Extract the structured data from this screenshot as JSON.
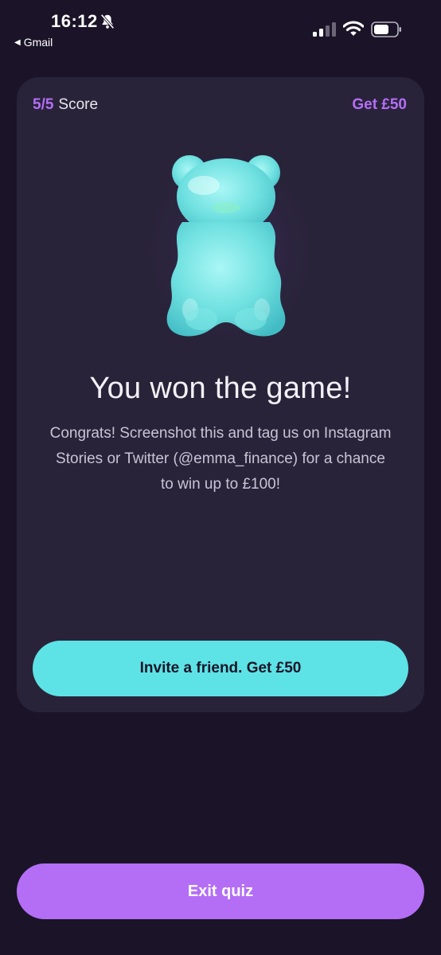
{
  "status_bar": {
    "time": "16:12",
    "back_app": "Gmail"
  },
  "card": {
    "score_value": "5/5",
    "score_label": "Score",
    "get_link": "Get £50",
    "title": "You won the game!",
    "message": "Congrats! Screenshot this and tag us on Instagram Stories or Twitter (@emma_finance) for a chance to win up to £100!",
    "invite_button": "Invite a friend. Get £50"
  },
  "footer": {
    "exit_button": "Exit quiz"
  },
  "colors": {
    "background": "#1b1428",
    "card": "#29233a",
    "accent_purple": "#b46ef5",
    "accent_cyan": "#5de3e6"
  },
  "icons": [
    "bell-slash-icon",
    "back-arrow-icon",
    "signal-icon",
    "wifi-icon",
    "battery-icon",
    "gummy-bear-illustration"
  ]
}
